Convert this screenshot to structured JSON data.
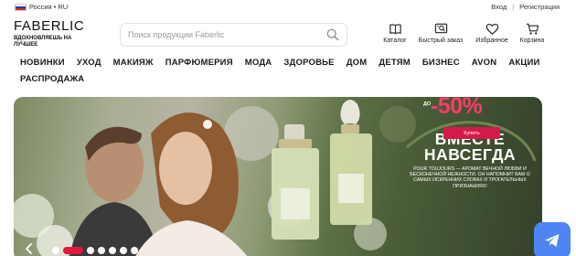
{
  "topbar": {
    "region_label": "Россия • RU",
    "login_label": "Вход",
    "separator": "|",
    "register_label": "Регистрация",
    "flag_colors": [
      "#ffffff",
      "#1c3fa8",
      "#d52b1e"
    ]
  },
  "header": {
    "logo_text": "FABERLIC",
    "tagline": "ВДОХНОВЛЯЕШЬ НА ЛУЧШЕЕ",
    "search_placeholder": "Поиск продукции Faberlic",
    "search_icon": "search-icon",
    "tools": [
      {
        "label": "Каталог",
        "icon": "book-icon"
      },
      {
        "label": "Быстрый заказ",
        "icon": "quick-order-icon"
      },
      {
        "label": "Избранное",
        "icon": "heart-icon"
      },
      {
        "label": "Корзина",
        "icon": "cart-icon"
      }
    ]
  },
  "nav": {
    "items": [
      "НОВИНКИ",
      "УХОД",
      "МАКИЯЖ",
      "ПАРФЮМЕРИЯ",
      "МОДА",
      "ЗДОРОВЬЕ",
      "ДОМ",
      "ДЕТЯМ",
      "БИЗНЕС",
      "AVON",
      "АКЦИИ"
    ],
    "items_row2": [
      "РАСПРОДАЖА"
    ]
  },
  "banner": {
    "title_line1": "ВМЕСТЕ",
    "title_line2": "НАВСЕГДА",
    "description": "POUR TOUJOURS — АРОМАТ ВЕЧНОЙ ЛЮБВИ И БЕСКОНЕЧНОЙ НЕЖНОСТИ. ОН НАПОМНИТ ВАМ О САМЫХ ИСКРЕННИХ СЛОВАХ И ТРОГАТЕЛЬНЫХ ПРИЗНАНИЯХ!",
    "sale_prefix": "ДО",
    "sale_value": "-50%",
    "button_label": "Купить",
    "accent_color": "#d6194b",
    "slides_total": 7,
    "active_slide": 1
  },
  "telegram": {
    "icon": "telegram-icon",
    "color": "#4f84f5"
  }
}
